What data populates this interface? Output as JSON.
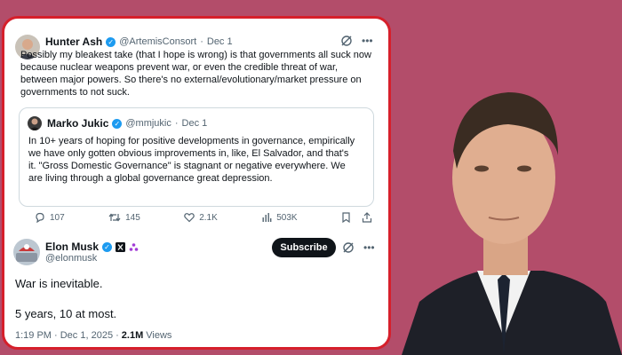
{
  "tweet": {
    "author_name": "Hunter Ash",
    "author_handle": "@ArtemisConsort",
    "separator": "·",
    "date": "Dec 1",
    "text": "Possibly my bleakest take (that I hope is wrong) is that governments all suck now because nuclear weapons prevent war, or even the credible threat of war, between major powers. So there's no external/evolutionary/market pressure on governments to not suck.",
    "quote": {
      "author_name": "Marko Jukic",
      "author_handle": "@mmjukic",
      "date": "Dec 1",
      "text": "In 10+ years of hoping for positive developments in governance, empirically we have only gotten obvious improvements in, like, El Salvador, and that's it. \"Gross Domestic Governance\" is stagnant or negative everywhere. We are living through a global governance great depression."
    },
    "actions": {
      "replies": "107",
      "reposts": "145",
      "likes": "2.1K",
      "views": "503K"
    }
  },
  "reply": {
    "author_name": "Elon Musk",
    "author_handle": "@elonmusk",
    "subscribe_label": "Subscribe",
    "text_line1": "War is inevitable.",
    "text_line2": "5 years, 10 at most.",
    "timestamp": "1:19 PM · Dec 1, 2025 · ",
    "views_count": "2.1M",
    "views_label": "Views"
  },
  "colors": {
    "background": "#b34d6a",
    "card_border": "#d61f2b",
    "verified": "#1d9bf0",
    "muted_text": "#536471"
  },
  "icons": [
    "verified-badge-icon",
    "grok-icon",
    "more-icon",
    "reply-icon",
    "repost-icon",
    "like-icon",
    "views-icon",
    "bookmark-icon",
    "share-icon",
    "x-logo-icon",
    "affiliate-icon"
  ]
}
